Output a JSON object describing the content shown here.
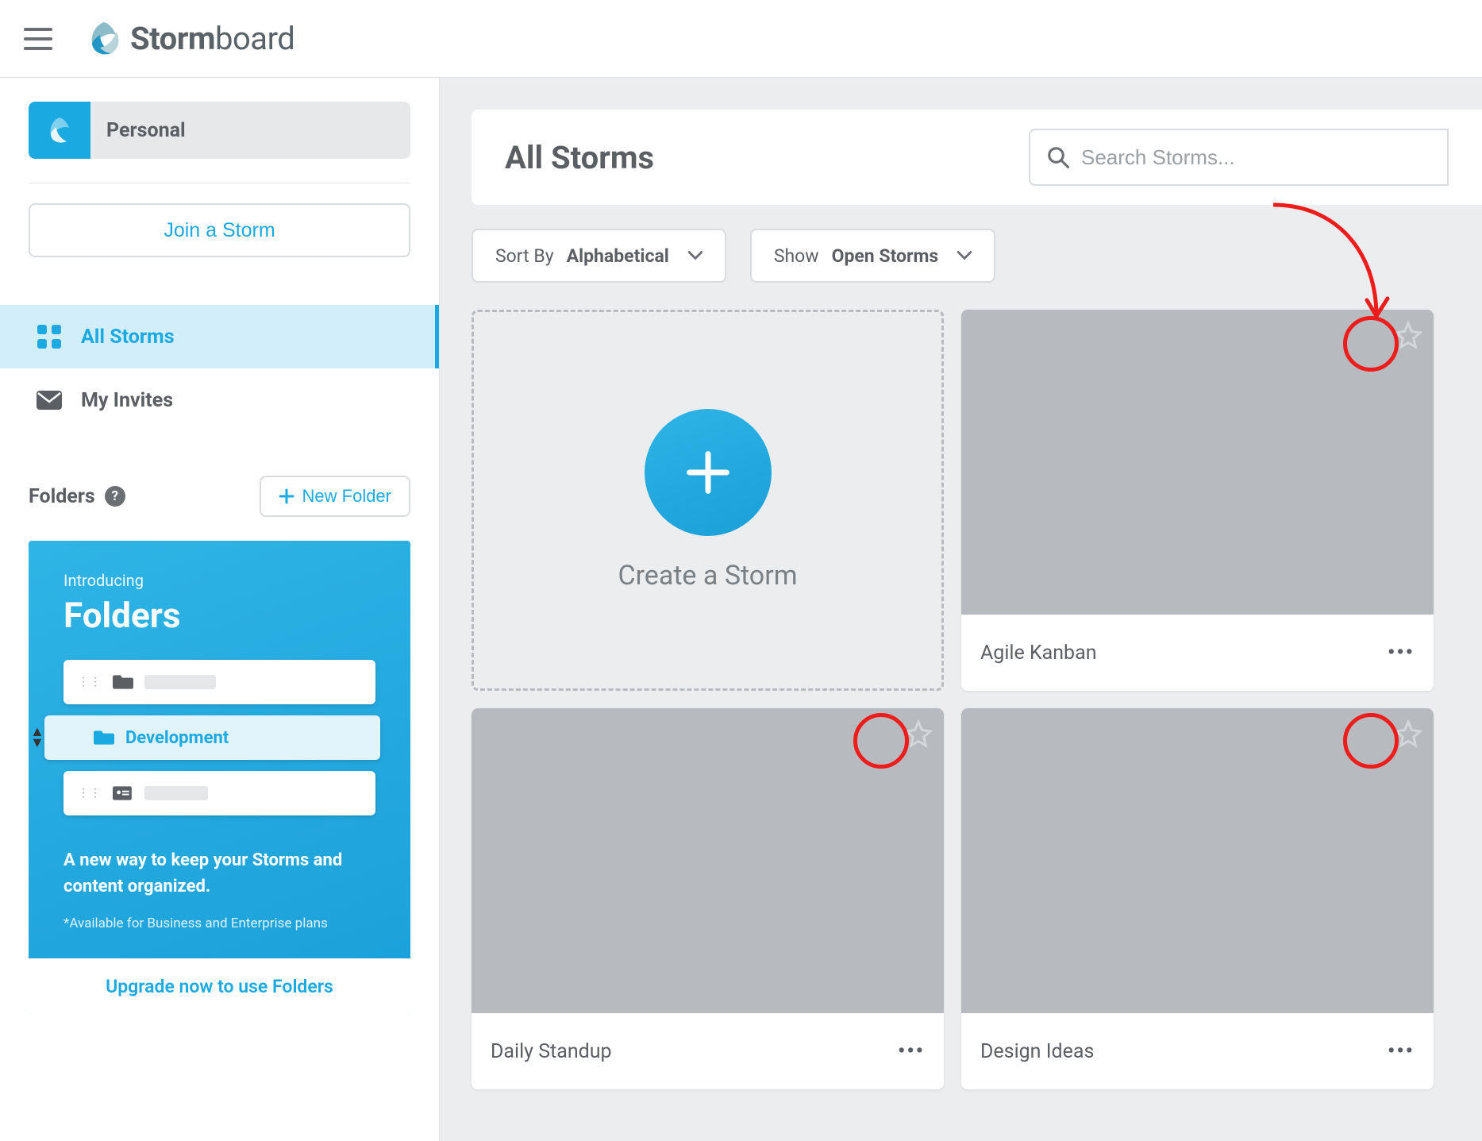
{
  "header": {
    "brand_bold": "Storm",
    "brand_rest": "board"
  },
  "sidebar": {
    "workspace_label": "Personal",
    "join_storm_label": "Join a Storm",
    "nav": {
      "all_storms": "All Storms",
      "my_invites": "My Invites"
    },
    "folders_label": "Folders",
    "new_folder_label": "New Folder",
    "promo": {
      "subtitle": "Introducing",
      "title": "Folders",
      "dev_label": "Development",
      "desc": "A new way to keep your Storms and content organized.",
      "note": "*Available for Business and Enterprise plans",
      "cta": "Upgrade now to use Folders"
    }
  },
  "main": {
    "title": "All Storms",
    "search_placeholder": "Search Storms...",
    "sort_label": "Sort By ",
    "sort_value": "Alphabetical",
    "show_label": "Show ",
    "show_value": "Open Storms",
    "create_label": "Create a Storm",
    "storms": [
      {
        "title": "Agile Kanban"
      },
      {
        "title": "Daily Standup"
      },
      {
        "title": "Design Ideas"
      }
    ]
  }
}
